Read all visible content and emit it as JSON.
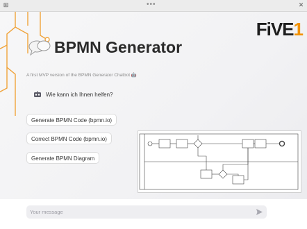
{
  "window": {
    "menu_glyph": "•••",
    "pin_glyph": "⊞",
    "close_glyph": "✕"
  },
  "brand": {
    "logo_main": "FiVE",
    "logo_accent": "1",
    "accent_color": "#f29200"
  },
  "header": {
    "title": "BPMN Generator",
    "subtitle": "A first MVP version of the BPMN Generator Chatbot 🤖"
  },
  "chat": {
    "assistant_message": "Wie kann ich Ihnen helfen?"
  },
  "actions": [
    {
      "label": "Generate BPMN Code (bpmn.io)"
    },
    {
      "label": "Correct BPMN Code (bpmn.io)"
    },
    {
      "label": "Generate BPMN Diagram"
    }
  ],
  "composer": {
    "placeholder": "Your message"
  }
}
